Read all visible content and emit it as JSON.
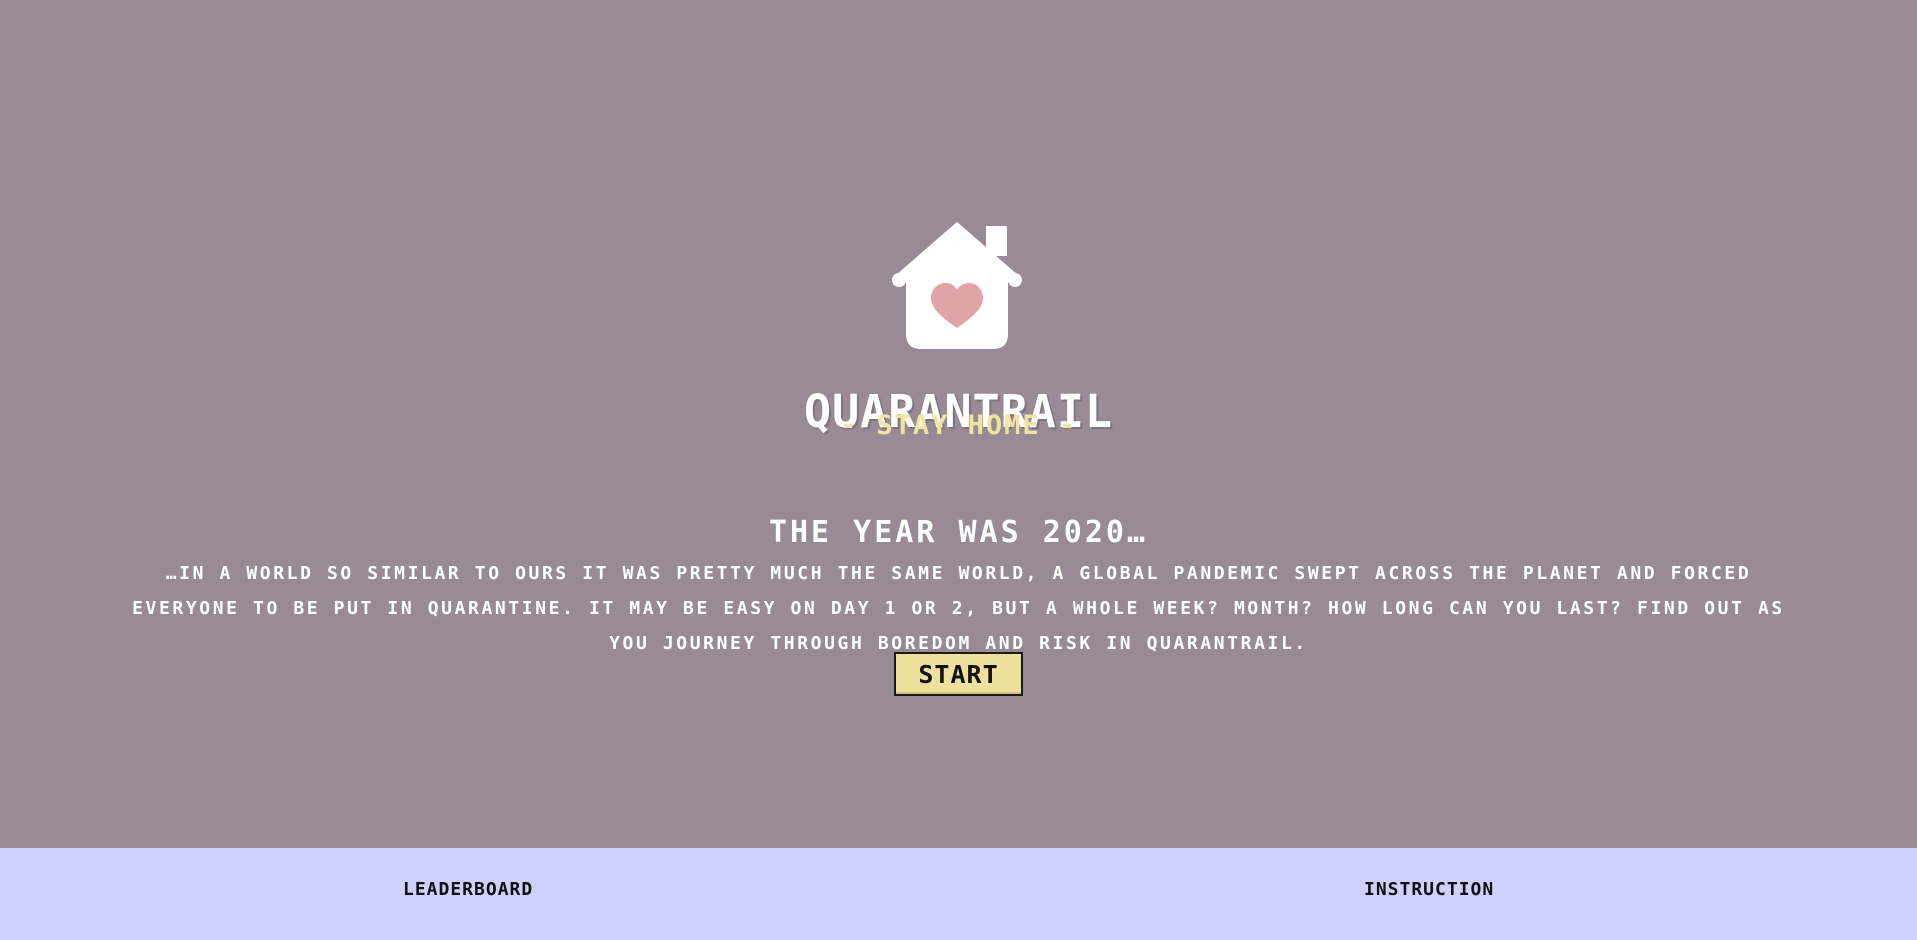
{
  "app": {
    "title": "QUARANTRAIL",
    "subtitle": "- STAY HOME -",
    "logo_icon": "house-heart-icon"
  },
  "intro": {
    "heading": "THE YEAR WAS 2020…",
    "body": "…IN A WORLD SO SIMILAR TO OURS IT WAS PRETTY MUCH THE SAME WORLD, A GLOBAL PANDEMIC SWEPT ACROSS THE PLANET AND FORCED EVERYONE TO BE PUT IN QUARANTINE. IT MAY BE EASY ON DAY 1 OR 2, BUT A WHOLE WEEK? MONTH? HOW LONG CAN YOU LAST? FIND OUT AS YOU JOURNEY THROUGH BOREDOM AND RISK IN QUARANTRAIL."
  },
  "actions": {
    "start_label": "START"
  },
  "footer": {
    "leaderboard_label": "LEADERBOARD",
    "instruction_label": "INSTRUCTION"
  },
  "colors": {
    "background": "#988b95",
    "footer_background": "#cfd1fd",
    "accent_yellow": "#eee19e",
    "heart_pink": "#e0a4a6"
  }
}
